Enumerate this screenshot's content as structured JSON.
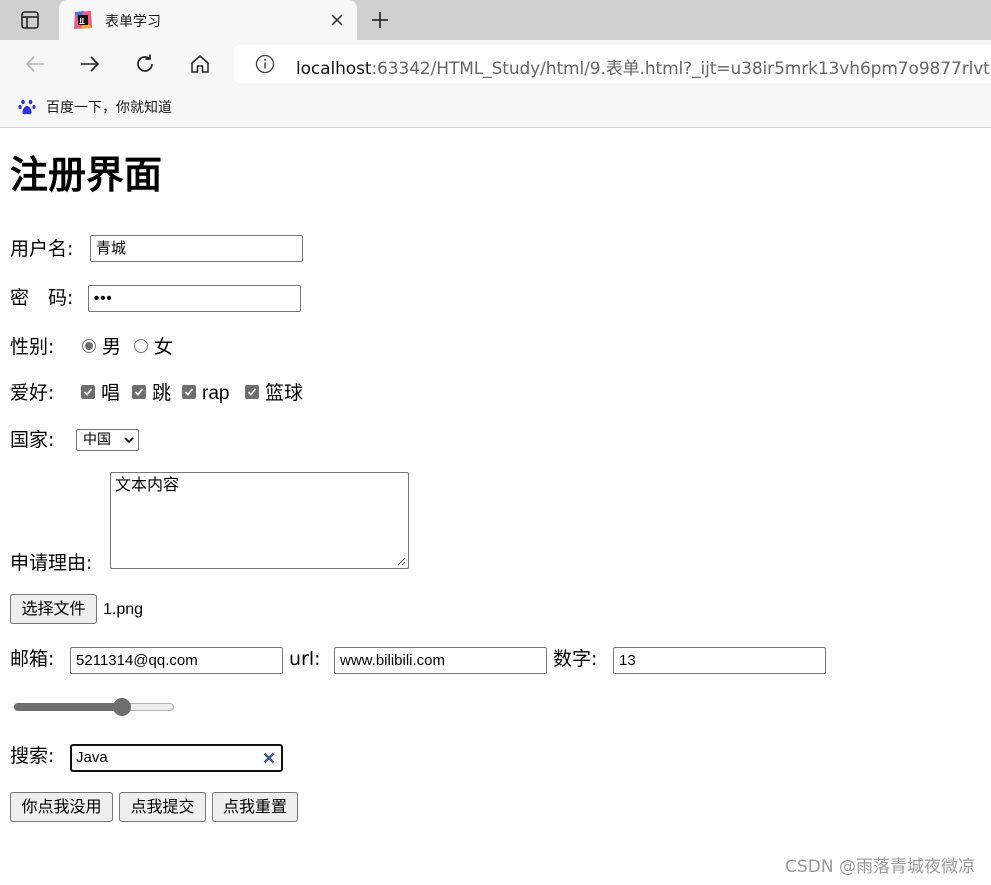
{
  "browser": {
    "tab": {
      "title": "表单学习",
      "favicon": "jetbrains-icon"
    },
    "address": {
      "host": "localhost",
      "path": ":63342/HTML_Study/html/9.表单.html?_ijt=u38ir5mrk13vh6pm7o9877rlvt"
    },
    "bookmarks": [
      {
        "label": "百度一下，你就知道",
        "icon": "baidu-paw-icon"
      }
    ]
  },
  "form": {
    "title": "注册界面",
    "username": {
      "label": "用户名:",
      "value": "青城"
    },
    "password": {
      "label": "密　码:",
      "value": "•••"
    },
    "gender": {
      "label": "性别:",
      "options": [
        "男",
        "女"
      ],
      "selected": "男"
    },
    "hobbies": {
      "label": "爱好:",
      "options": [
        "唱",
        "跳",
        "rap",
        "篮球"
      ],
      "checked": [
        "唱",
        "跳",
        "rap",
        "篮球"
      ]
    },
    "country": {
      "label": "国家:",
      "selected": "中国"
    },
    "reason": {
      "label": "申请理由:",
      "value": "文本内容"
    },
    "file": {
      "button": "选择文件",
      "filename": "1.png"
    },
    "email": {
      "label": "邮箱:",
      "value": "5211314@qq.com"
    },
    "url": {
      "label": "url:",
      "value": "www.bilibili.com"
    },
    "number": {
      "label": "数字:",
      "value": "13"
    },
    "range": {
      "fraction": 0.68
    },
    "search": {
      "label": "搜索:",
      "value": "Java"
    },
    "buttons": {
      "useless": "你点我没用",
      "submit": "点我提交",
      "reset": "点我重置"
    }
  },
  "watermark": "CSDN @雨落青城夜微凉",
  "colors": {
    "tabstrip": "#cfcfcf",
    "toolbar": "#f7f7f7",
    "control_fill": "#6e6e6e",
    "search_clear": "#3c5a8a"
  }
}
